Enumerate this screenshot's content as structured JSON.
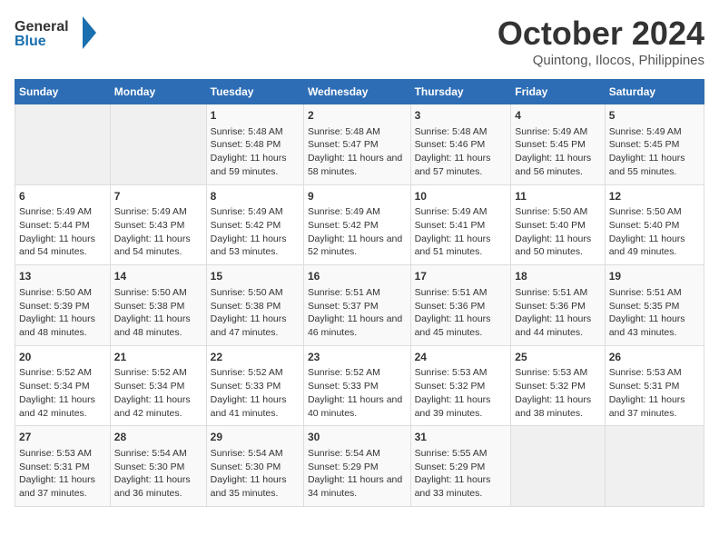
{
  "logo": {
    "line1": "General",
    "line2": "Blue"
  },
  "title": "October 2024",
  "subtitle": "Quintong, Ilocos, Philippines",
  "days_of_week": [
    "Sunday",
    "Monday",
    "Tuesday",
    "Wednesday",
    "Thursday",
    "Friday",
    "Saturday"
  ],
  "weeks": [
    [
      {
        "day": "",
        "info": ""
      },
      {
        "day": "",
        "info": ""
      },
      {
        "day": "1",
        "info": "Sunrise: 5:48 AM\nSunset: 5:48 PM\nDaylight: 11 hours and 59 minutes."
      },
      {
        "day": "2",
        "info": "Sunrise: 5:48 AM\nSunset: 5:47 PM\nDaylight: 11 hours and 58 minutes."
      },
      {
        "day": "3",
        "info": "Sunrise: 5:48 AM\nSunset: 5:46 PM\nDaylight: 11 hours and 57 minutes."
      },
      {
        "day": "4",
        "info": "Sunrise: 5:49 AM\nSunset: 5:45 PM\nDaylight: 11 hours and 56 minutes."
      },
      {
        "day": "5",
        "info": "Sunrise: 5:49 AM\nSunset: 5:45 PM\nDaylight: 11 hours and 55 minutes."
      }
    ],
    [
      {
        "day": "6",
        "info": "Sunrise: 5:49 AM\nSunset: 5:44 PM\nDaylight: 11 hours and 54 minutes."
      },
      {
        "day": "7",
        "info": "Sunrise: 5:49 AM\nSunset: 5:43 PM\nDaylight: 11 hours and 54 minutes."
      },
      {
        "day": "8",
        "info": "Sunrise: 5:49 AM\nSunset: 5:42 PM\nDaylight: 11 hours and 53 minutes."
      },
      {
        "day": "9",
        "info": "Sunrise: 5:49 AM\nSunset: 5:42 PM\nDaylight: 11 hours and 52 minutes."
      },
      {
        "day": "10",
        "info": "Sunrise: 5:49 AM\nSunset: 5:41 PM\nDaylight: 11 hours and 51 minutes."
      },
      {
        "day": "11",
        "info": "Sunrise: 5:50 AM\nSunset: 5:40 PM\nDaylight: 11 hours and 50 minutes."
      },
      {
        "day": "12",
        "info": "Sunrise: 5:50 AM\nSunset: 5:40 PM\nDaylight: 11 hours and 49 minutes."
      }
    ],
    [
      {
        "day": "13",
        "info": "Sunrise: 5:50 AM\nSunset: 5:39 PM\nDaylight: 11 hours and 48 minutes."
      },
      {
        "day": "14",
        "info": "Sunrise: 5:50 AM\nSunset: 5:38 PM\nDaylight: 11 hours and 48 minutes."
      },
      {
        "day": "15",
        "info": "Sunrise: 5:50 AM\nSunset: 5:38 PM\nDaylight: 11 hours and 47 minutes."
      },
      {
        "day": "16",
        "info": "Sunrise: 5:51 AM\nSunset: 5:37 PM\nDaylight: 11 hours and 46 minutes."
      },
      {
        "day": "17",
        "info": "Sunrise: 5:51 AM\nSunset: 5:36 PM\nDaylight: 11 hours and 45 minutes."
      },
      {
        "day": "18",
        "info": "Sunrise: 5:51 AM\nSunset: 5:36 PM\nDaylight: 11 hours and 44 minutes."
      },
      {
        "day": "19",
        "info": "Sunrise: 5:51 AM\nSunset: 5:35 PM\nDaylight: 11 hours and 43 minutes."
      }
    ],
    [
      {
        "day": "20",
        "info": "Sunrise: 5:52 AM\nSunset: 5:34 PM\nDaylight: 11 hours and 42 minutes."
      },
      {
        "day": "21",
        "info": "Sunrise: 5:52 AM\nSunset: 5:34 PM\nDaylight: 11 hours and 42 minutes."
      },
      {
        "day": "22",
        "info": "Sunrise: 5:52 AM\nSunset: 5:33 PM\nDaylight: 11 hours and 41 minutes."
      },
      {
        "day": "23",
        "info": "Sunrise: 5:52 AM\nSunset: 5:33 PM\nDaylight: 11 hours and 40 minutes."
      },
      {
        "day": "24",
        "info": "Sunrise: 5:53 AM\nSunset: 5:32 PM\nDaylight: 11 hours and 39 minutes."
      },
      {
        "day": "25",
        "info": "Sunrise: 5:53 AM\nSunset: 5:32 PM\nDaylight: 11 hours and 38 minutes."
      },
      {
        "day": "26",
        "info": "Sunrise: 5:53 AM\nSunset: 5:31 PM\nDaylight: 11 hours and 37 minutes."
      }
    ],
    [
      {
        "day": "27",
        "info": "Sunrise: 5:53 AM\nSunset: 5:31 PM\nDaylight: 11 hours and 37 minutes."
      },
      {
        "day": "28",
        "info": "Sunrise: 5:54 AM\nSunset: 5:30 PM\nDaylight: 11 hours and 36 minutes."
      },
      {
        "day": "29",
        "info": "Sunrise: 5:54 AM\nSunset: 5:30 PM\nDaylight: 11 hours and 35 minutes."
      },
      {
        "day": "30",
        "info": "Sunrise: 5:54 AM\nSunset: 5:29 PM\nDaylight: 11 hours and 34 minutes."
      },
      {
        "day": "31",
        "info": "Sunrise: 5:55 AM\nSunset: 5:29 PM\nDaylight: 11 hours and 33 minutes."
      },
      {
        "day": "",
        "info": ""
      },
      {
        "day": "",
        "info": ""
      }
    ]
  ]
}
